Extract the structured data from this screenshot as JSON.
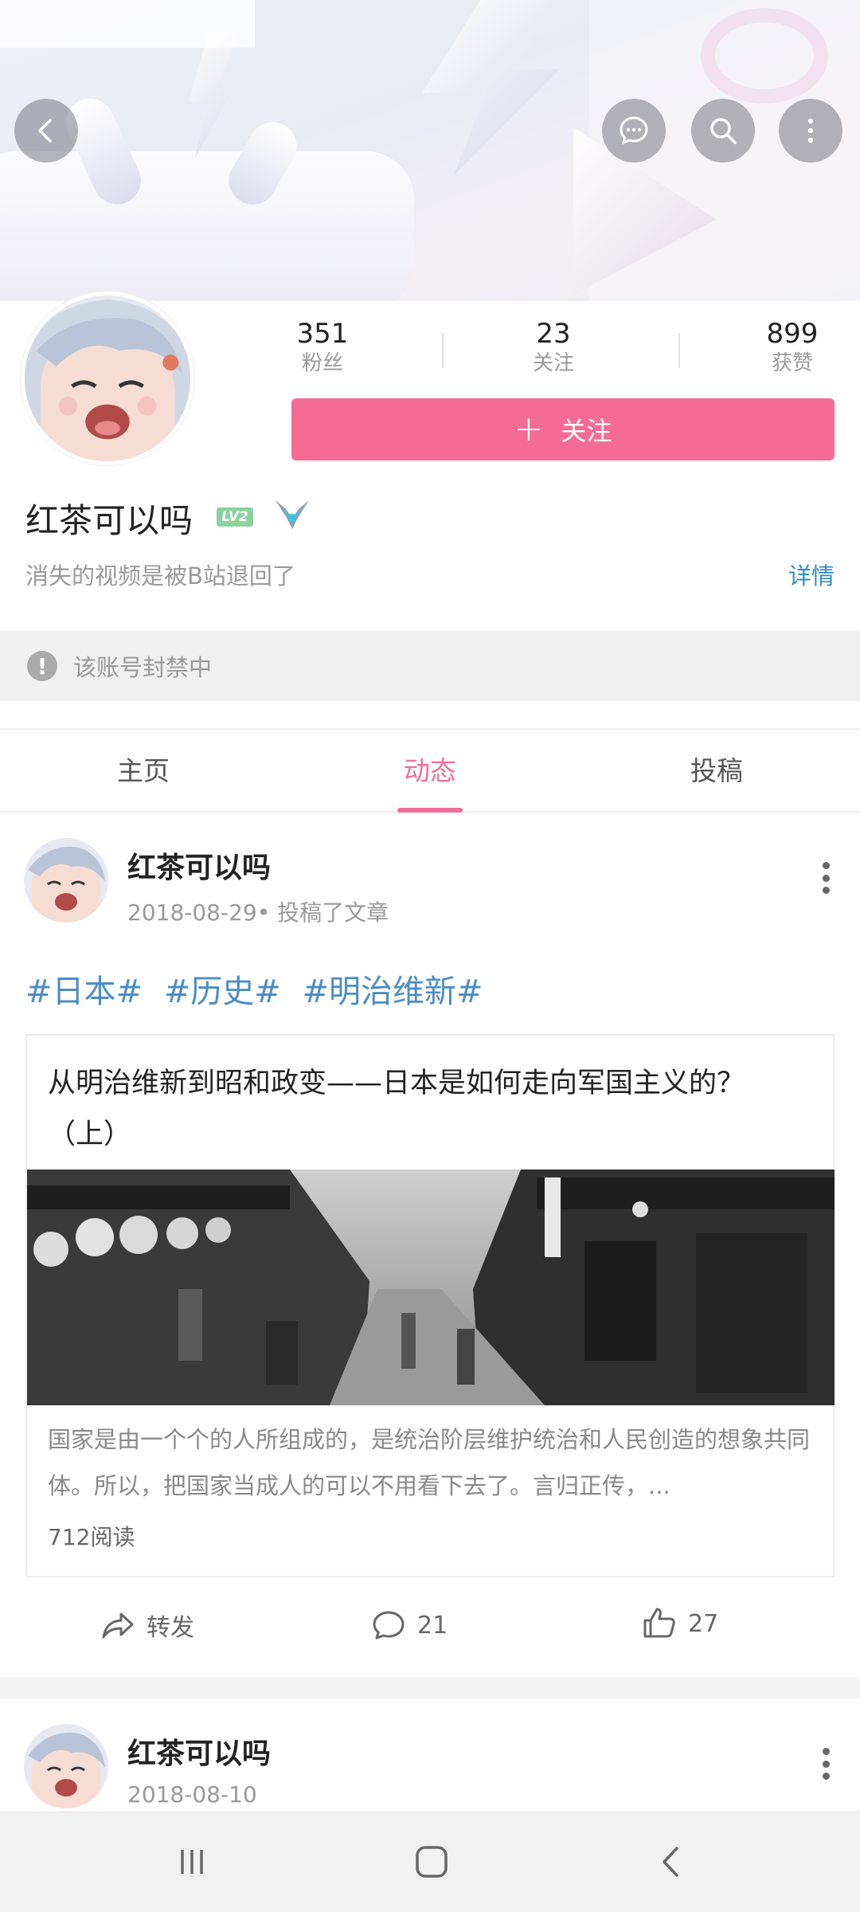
{
  "profile": {
    "username": "红茶可以吗",
    "level": "LV2",
    "signature": "消失的视频是被B站退回了",
    "detail_link": "详情",
    "follow_button": "关注",
    "banned_notice": "该账号封禁中",
    "stats": [
      {
        "value": "351",
        "label": "粉丝"
      },
      {
        "value": "23",
        "label": "关注"
      },
      {
        "value": "899",
        "label": "获赞"
      }
    ]
  },
  "header_icons": [
    "back-icon",
    "message-icon",
    "search-icon",
    "more-icon"
  ],
  "tabs": [
    {
      "label": "主页",
      "active": false
    },
    {
      "label": "动态",
      "active": true
    },
    {
      "label": "投稿",
      "active": false
    }
  ],
  "posts": [
    {
      "author": "红茶可以吗",
      "meta": "2018-08-29• 投稿了文章",
      "tags": [
        "#日本#",
        "#历史#",
        "#明治维新#"
      ],
      "article": {
        "title": "从明治维新到昭和政变——日本是如何走向军国主义的？（上）",
        "excerpt": "国家是由一个个的人所组成的，是统治阶层维护统治和人民创造的想象共同体。所以，把国家当成人的可以不用看下去了。言归正传，...",
        "reads": "712阅读"
      },
      "actions": {
        "share": "转发",
        "comments": "21",
        "likes": "27"
      }
    },
    {
      "author": "红茶可以吗",
      "meta": "2018-08-10"
    }
  ],
  "colors": {
    "accent": "#f46c95",
    "link": "#2e8dc0",
    "tag": "#4b8dc4",
    "level_badge": "#8bd29c"
  }
}
